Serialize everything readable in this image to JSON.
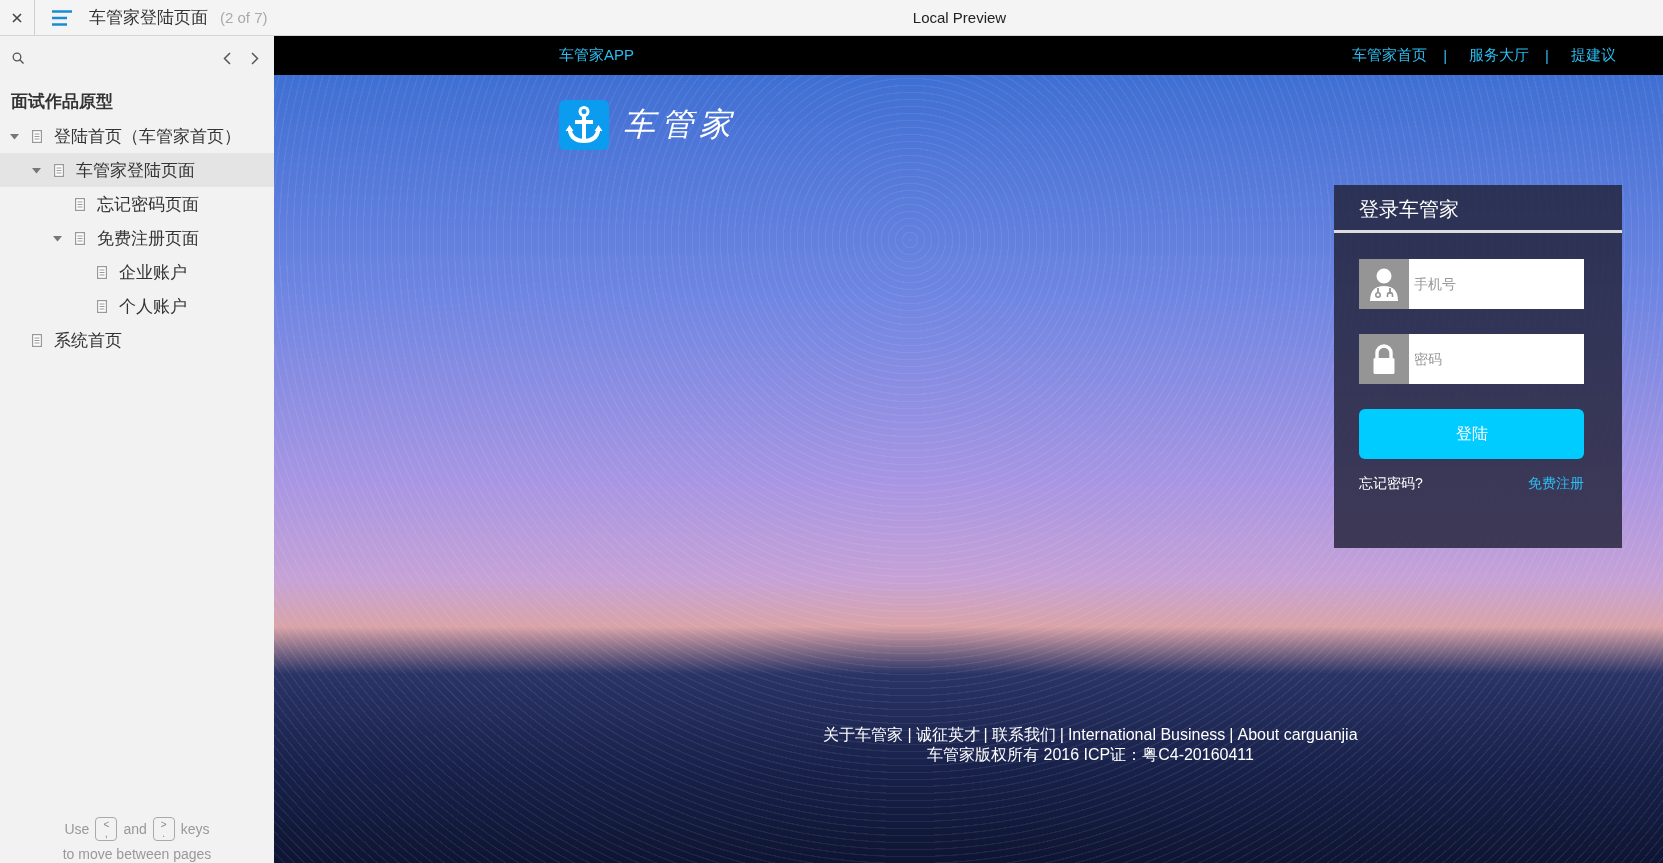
{
  "toolbar": {
    "page_title": "车管家登陆页面",
    "page_count": "(2 of 7)",
    "preview_label": "Local Preview"
  },
  "sidebar": {
    "title": "面试作品原型",
    "tree": [
      {
        "label": "登陆首页（车管家首页）",
        "expanded": true,
        "selected": false,
        "children": [
          {
            "label": "车管家登陆页面",
            "expanded": true,
            "selected": true,
            "children": [
              {
                "label": "忘记密码页面",
                "selected": false
              },
              {
                "label": "免费注册页面",
                "expanded": true,
                "selected": false,
                "children": [
                  {
                    "label": "企业账户",
                    "selected": false
                  },
                  {
                    "label": "个人账户",
                    "selected": false
                  }
                ]
              }
            ]
          }
        ]
      },
      {
        "label": "系统首页",
        "selected": false
      }
    ],
    "hint": {
      "line1": [
        {
          "kind": "text",
          "text": "Use"
        },
        {
          "kind": "key",
          "top": "<",
          "bottom": ","
        },
        {
          "kind": "text",
          "text": "and"
        },
        {
          "kind": "key",
          "top": ">",
          "bottom": "."
        },
        {
          "kind": "text",
          "text": "keys"
        }
      ],
      "line2": "to move between pages"
    }
  },
  "site": {
    "nav": {
      "brand": "车管家APP",
      "links": [
        "车管家首页",
        "服务大厅",
        "提建议"
      ],
      "separator": "|"
    },
    "logo_text": "车管家",
    "login": {
      "title": "登录车管家",
      "fields": [
        {
          "kind": "phone",
          "placeholder": "手机号"
        },
        {
          "kind": "password",
          "placeholder": "密码"
        }
      ],
      "submit": "登陆",
      "forgot": "忘记密码?",
      "register": "免费注册"
    },
    "footer": {
      "links": [
        "关于车管家",
        "诚征英才",
        "联系我们",
        "International Business",
        "About carguanjia"
      ],
      "separator": "|",
      "copyright": "车管家版权所有 2016 ICP证：粤C4-20160411"
    }
  }
}
